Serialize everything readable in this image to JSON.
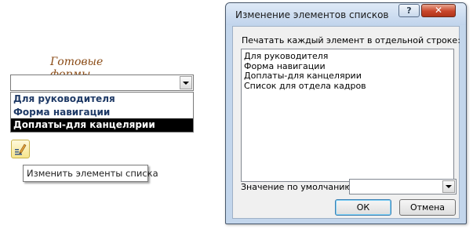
{
  "form": {
    "title": "Готовые формы",
    "combo_value": "",
    "dropdown_items": [
      {
        "label": "Для руководителя"
      },
      {
        "label": "Форма навигации"
      },
      {
        "label": "Доплаты-для канцелярии"
      }
    ],
    "selected_index": 2,
    "edit_icon": "edit-list-icon",
    "tooltip": "Изменить элементы списка"
  },
  "dialog": {
    "title": "Изменение элементов списков",
    "help_label": "?",
    "close_label": "✕",
    "list_label": "Печатать каждый элемент в отдельной строке:",
    "items_text": [
      "Для руководителя",
      "Форма навигации",
      "Доплаты-для канцелярии",
      "Список для отдела кадров"
    ],
    "default_label": "Значение по умолчанию:",
    "default_value": "",
    "ok_label": "ОК",
    "cancel_label": "Отмена"
  },
  "colors": {
    "form_title": "#8a4a14",
    "dropdown_text": "#1f3a66",
    "selection_bg": "#000000",
    "dialog_frame": "#c3d6ec",
    "close_button": "#c9462b"
  }
}
